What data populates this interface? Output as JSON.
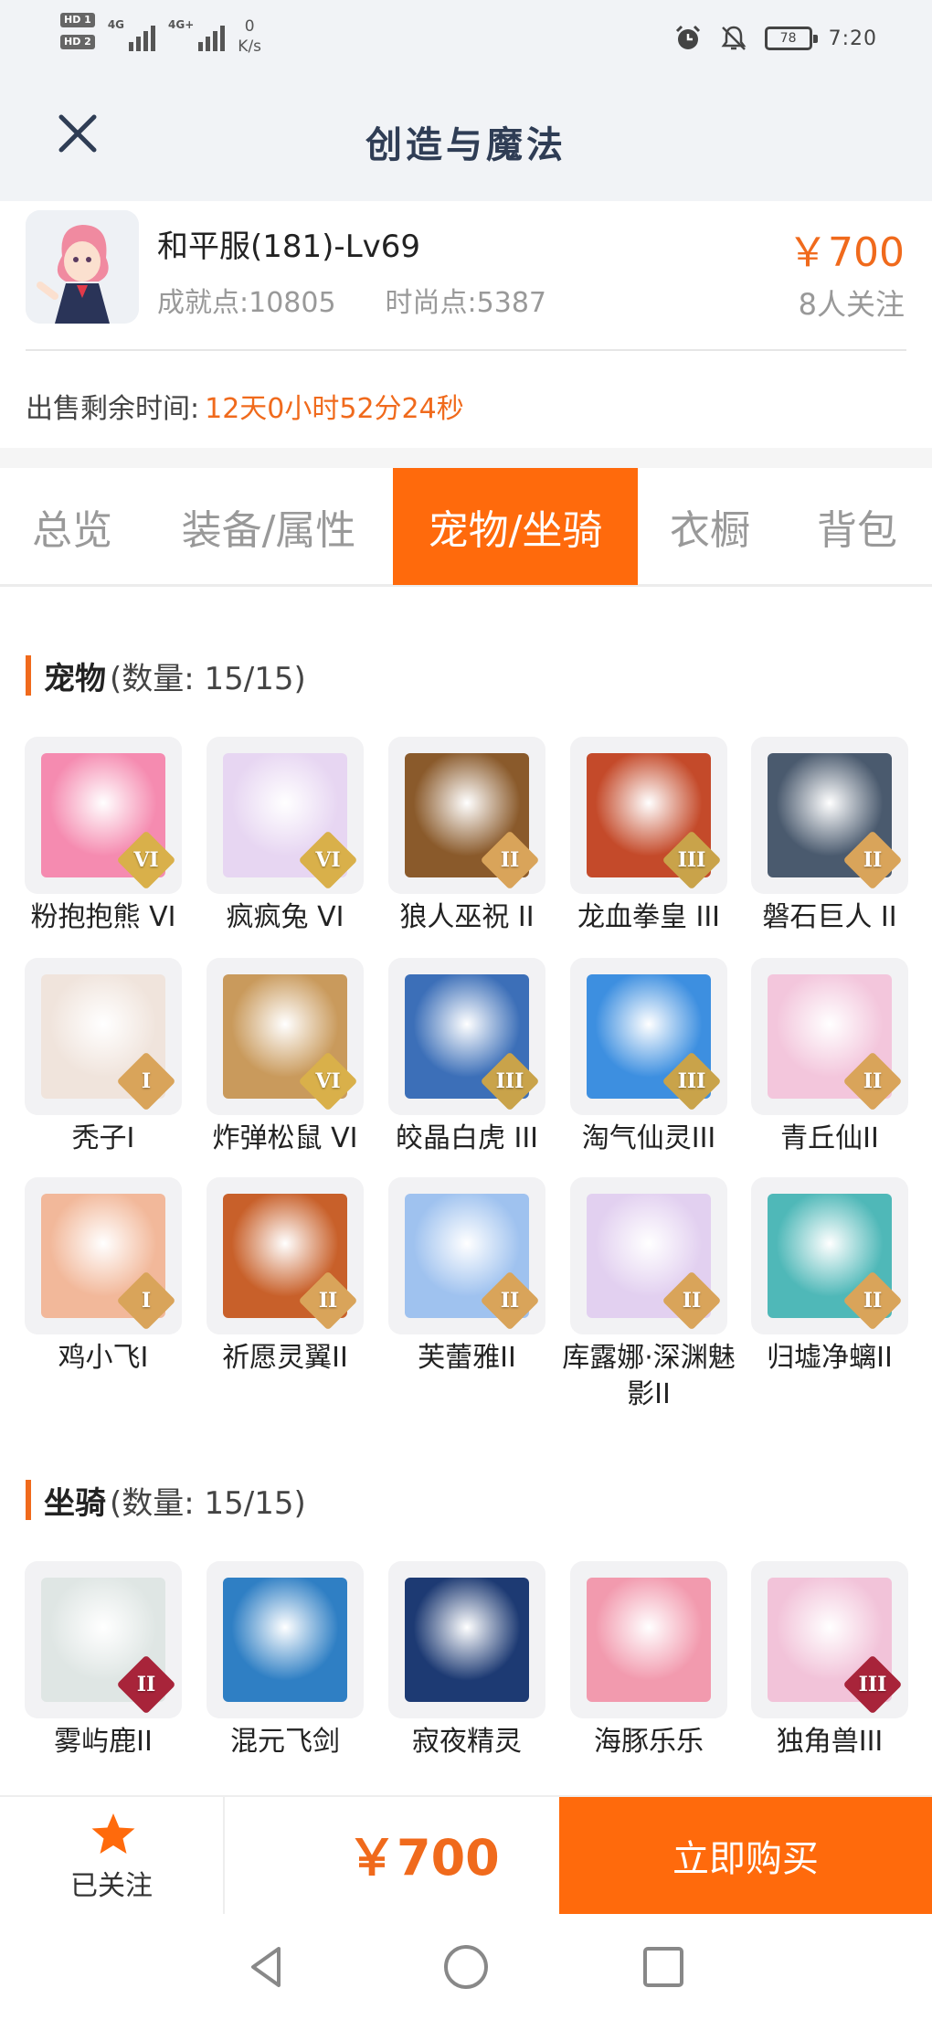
{
  "status_bar": {
    "hd1": "HD 1",
    "hd2": "HD 2",
    "net1": "4G",
    "net2": "4G+",
    "speed_value": "0",
    "speed_unit": "K/s",
    "battery": "78",
    "time": "7:20"
  },
  "header": {
    "title": "创造与魔法"
  },
  "account": {
    "name": "和平服(181)-Lv69",
    "achievement": "成就点:10805",
    "fashion": "时尚点:5387",
    "price": "￥700",
    "followers": "8人关注",
    "remain_label": "出售剩余时间:",
    "remain_value": "12天0小时52分24秒"
  },
  "tabs": [
    {
      "label": "总览"
    },
    {
      "label": "装备/属性"
    },
    {
      "label": "宠物/坐骑",
      "active": true
    },
    {
      "label": "衣橱"
    },
    {
      "label": "背包"
    }
  ],
  "pets_section": {
    "title": "宠物",
    "count": "(数量: 15/15)",
    "items": [
      {
        "name": "粉抱抱熊 VI",
        "tier": "VI",
        "color": "#f58bb0"
      },
      {
        "name": "疯疯兔 VI",
        "tier": "VI",
        "color": "#e7d6f2"
      },
      {
        "name": "狼人巫祝 II",
        "tier": "II",
        "color": "#8a5a2b"
      },
      {
        "name": "龙血拳皇 III",
        "tier": "III",
        "color": "#c44a2a"
      },
      {
        "name": "磐石巨人 II",
        "tier": "II",
        "color": "#4a5a6e"
      },
      {
        "name": "秃子I",
        "tier": "I",
        "color": "#f0e4dc"
      },
      {
        "name": "炸弹松鼠 VI",
        "tier": "VI",
        "color": "#c99a5c"
      },
      {
        "name": "皎晶白虎 III",
        "tier": "III",
        "color": "#3c6fb8"
      },
      {
        "name": "淘气仙灵III",
        "tier": "III",
        "color": "#3d8fe0"
      },
      {
        "name": "青丘仙II",
        "tier": "II",
        "color": "#f3c6dc"
      },
      {
        "name": "鸡小飞I",
        "tier": "I",
        "color": "#f2b89a"
      },
      {
        "name": "祈愿灵翼II",
        "tier": "II",
        "color": "#c8602a"
      },
      {
        "name": "芙蕾雅II",
        "tier": "II",
        "color": "#9fc2ef"
      },
      {
        "name": "库露娜·深渊魅影II",
        "tier": "II",
        "color": "#e2d0f0"
      },
      {
        "name": "归墟净螭II",
        "tier": "II",
        "color": "#4fb8b8"
      }
    ]
  },
  "mounts_section": {
    "title": "坐骑",
    "count": "(数量: 15/15)",
    "items": [
      {
        "name": "雾屿鹿II",
        "tier": "II",
        "color": "#dfe6e4"
      },
      {
        "name": "混元飞剑",
        "tier": "",
        "color": "#2f7fc4"
      },
      {
        "name": "寂夜精灵",
        "tier": "",
        "color": "#1d3a73"
      },
      {
        "name": "海豚乐乐",
        "tier": "",
        "color": "#f29aae"
      },
      {
        "name": "独角兽III",
        "tier": "III",
        "color": "#f2c3d9"
      }
    ]
  },
  "bottom_bar": {
    "follow_label": "已关注",
    "price": "￥700",
    "buy_label": "立即购买"
  }
}
